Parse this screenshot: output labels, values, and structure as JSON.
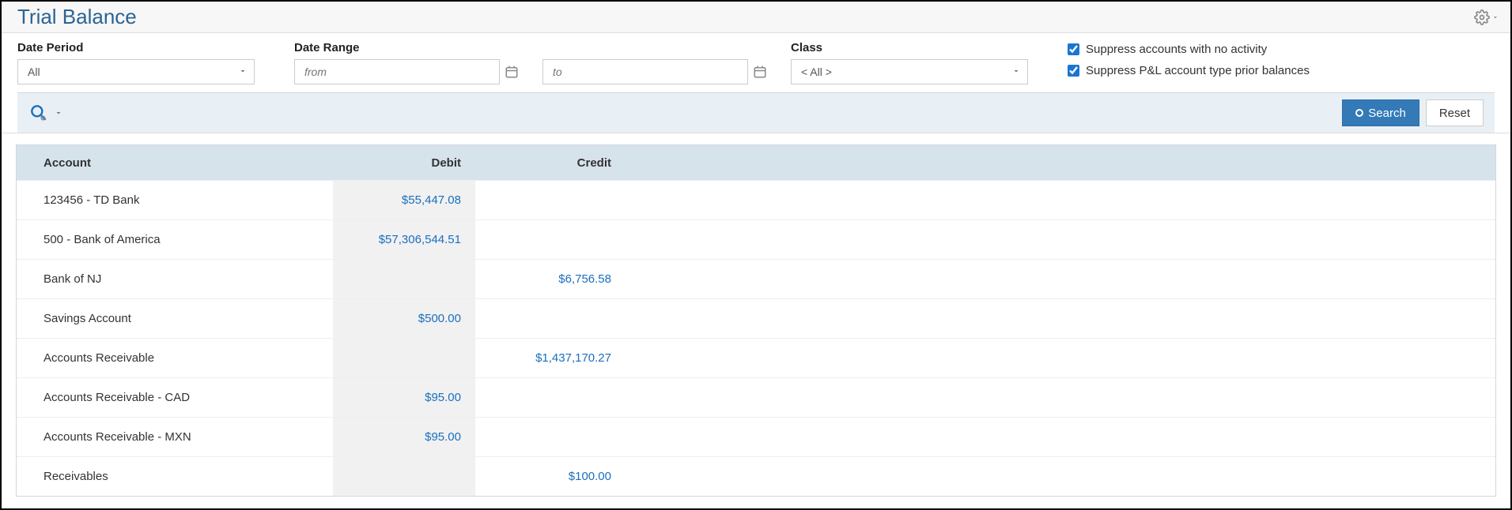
{
  "header": {
    "title": "Trial Balance"
  },
  "filters": {
    "date_period": {
      "label": "Date Period",
      "value": "All"
    },
    "date_range": {
      "label": "Date Range",
      "from_placeholder": "from",
      "to_placeholder": "to"
    },
    "class": {
      "label": "Class",
      "value": "< All >"
    },
    "suppress_no_activity": {
      "label": "Suppress accounts with no activity",
      "checked": true
    },
    "suppress_pl_prior": {
      "label": "Suppress P&L account type prior balances",
      "checked": true
    }
  },
  "buttons": {
    "search": "Search",
    "reset": "Reset"
  },
  "table": {
    "columns": {
      "account": "Account",
      "debit": "Debit",
      "credit": "Credit"
    },
    "rows": [
      {
        "account": "123456 - TD Bank",
        "debit": "$55,447.08",
        "credit": ""
      },
      {
        "account": "500 - Bank of America",
        "debit": "$57,306,544.51",
        "credit": ""
      },
      {
        "account": "Bank of NJ",
        "debit": "",
        "credit": "$6,756.58"
      },
      {
        "account": "Savings Account",
        "debit": "$500.00",
        "credit": ""
      },
      {
        "account": "Accounts Receivable",
        "debit": "",
        "credit": "$1,437,170.27"
      },
      {
        "account": "Accounts Receivable - CAD",
        "debit": "$95.00",
        "credit": ""
      },
      {
        "account": "Accounts Receivable - MXN",
        "debit": "$95.00",
        "credit": ""
      },
      {
        "account": "Receivables",
        "debit": "",
        "credit": "$100.00"
      }
    ]
  }
}
